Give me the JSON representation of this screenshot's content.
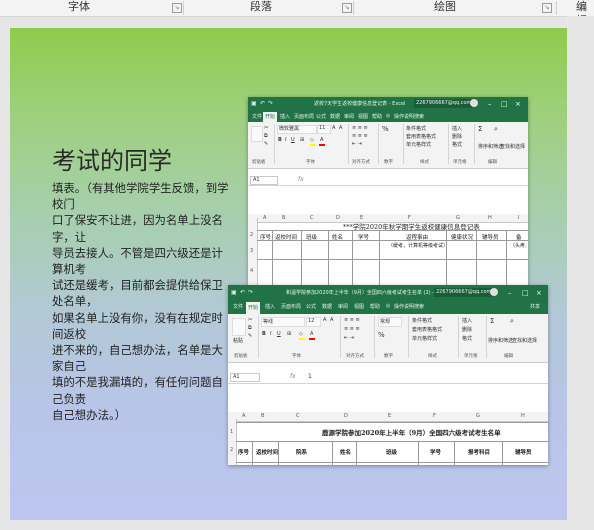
{
  "ribbon": {
    "groups": [
      "字体",
      "段落",
      "绘图",
      "编辑"
    ]
  },
  "slide": {
    "title": "考试的同学",
    "body_lines": [
      "填表。（有其他学院学生反馈，到学校门",
      "口了保安不让进，因为名单上没名字，让",
      "导员去接人。不管是四六级还是计算机考",
      "试还是缓考，目前都会提供给保卫处名单，",
      "如果名单上没有你，没有在规定时间返校",
      "进不来的，自己想办法，名单是大家自己",
      "填的不是我漏填的，有任何问题自己负责",
      "自己想办法。）"
    ]
  },
  "shot1": {
    "title": "返校7天学生返校健康信息登记表 - Excel",
    "account": "2267906667@qq.com",
    "tabs": [
      "文件",
      "开始",
      "插入",
      "页面布局",
      "公式",
      "数据",
      "审阅",
      "视图",
      "帮助",
      "操作说明搜索"
    ],
    "font_name": "微软雅黑",
    "font_size": "11",
    "ribbon_labels": [
      "剪贴板",
      "字体",
      "对齐方式",
      "数字",
      "样式",
      "单元格",
      "编辑"
    ],
    "style_items": [
      "条件格式",
      "套用表格格式",
      "单元格样式"
    ],
    "cell_items": [
      "插入",
      "删除",
      "格式"
    ],
    "edit_items": [
      "排序和筛选",
      "查找和选择"
    ],
    "name_box": "A1",
    "formula_symbol": "fx",
    "columns": [
      "A",
      "B",
      "C",
      "D",
      "E",
      "F",
      "G",
      "H",
      "I"
    ],
    "rows": [
      "1",
      "2",
      "3",
      "4"
    ],
    "sheet_title": "***学院2020年秋学期学生返校健康信息登记表",
    "headers": [
      "序号",
      "返校时间",
      "班级",
      "姓名",
      "学号",
      "返程事由",
      "健康状况",
      "辅导员",
      "备"
    ],
    "subheader": "（缓考，计算机等级考试）",
    "subheader2": "（头疼,"
  },
  "shot2": {
    "title": "和温学院参加2020年上半年（9月）全国四六级考试考生名单 (2) - Excel",
    "account": "2267906667@qq.com",
    "tabs": [
      "文件",
      "开始",
      "插入",
      "页面布局",
      "公式",
      "数据",
      "审阅",
      "视图",
      "帮助",
      "操作说明搜索"
    ],
    "share": "共享",
    "font_name": "等线",
    "font_size": "12",
    "ribbon_labels": [
      "剪贴板",
      "字体",
      "对齐方式",
      "数字",
      "样式",
      "单元格",
      "编辑"
    ],
    "paste": "粘贴",
    "number_format": "常规",
    "style_items": [
      "条件格式",
      "套用表格格式",
      "单元格样式"
    ],
    "cell_items": [
      "插入",
      "删除",
      "格式"
    ],
    "edit_items": [
      "排序和筛选",
      "查找和选择"
    ],
    "name_box": "A1",
    "formula_symbol": "fx",
    "formula_value": "1",
    "columns": [
      "A",
      "B",
      "C",
      "D",
      "E",
      "F",
      "G",
      "H"
    ],
    "rows": [
      "1",
      "2"
    ],
    "sheet_title": "鹿源学院参加2020年上半年（9月）全国四六级考试考生名单",
    "headers": [
      "序号",
      "返校时间",
      "院系",
      "姓名",
      "班级",
      "学号",
      "报考科目",
      "辅导员"
    ]
  },
  "colors": {
    "excel_green": "#217346",
    "slide_top": "#8fcc4c",
    "slide_bottom": "#bdc6ef"
  }
}
